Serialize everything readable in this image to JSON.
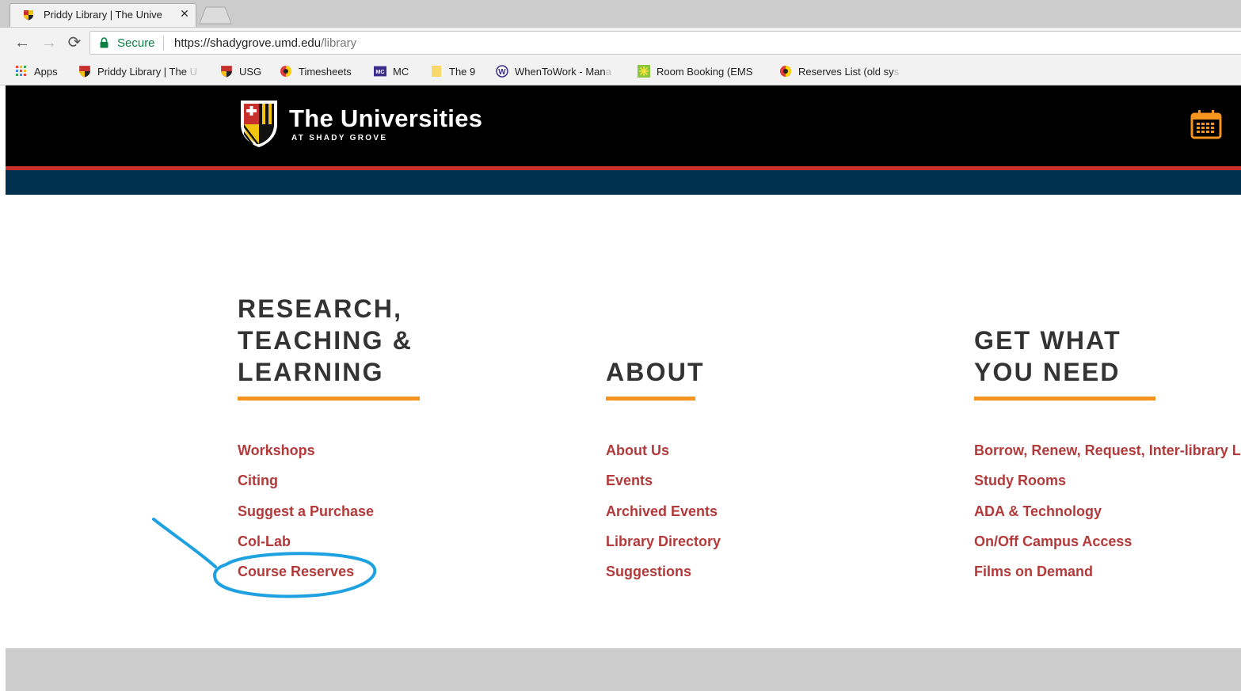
{
  "browser": {
    "tab_title": "Priddy Library | The Unive",
    "secure_label": "Secure",
    "url_host": "https://shadygrove.umd.edu",
    "url_path": "/library",
    "bookmarks": [
      {
        "label": "Apps",
        "icon": "apps-grid-icon"
      },
      {
        "label": "Priddy Library | The",
        "fade": " U",
        "icon": "usg-shield-icon"
      },
      {
        "label": "USG",
        "icon": "usg-shield-icon"
      },
      {
        "label": "Timesheets",
        "icon": "umd-globe-icon"
      },
      {
        "label": "MC",
        "icon": "mc-logo-icon"
      },
      {
        "label": "The 9",
        "icon": "folder-icon"
      },
      {
        "label": "WhenToWork - Man",
        "fade": "a",
        "icon": "whentowork-icon"
      },
      {
        "label": "Room Booking (EMS",
        "fade": "",
        "icon": "ems-icon"
      },
      {
        "label": "Reserves List (old sy",
        "fade": "s",
        "icon": "umd-globe-icon"
      }
    ]
  },
  "site": {
    "title": "The Universities",
    "subtitle": "AT SHADY GROVE"
  },
  "columns": [
    {
      "heading": [
        "RESEARCH,",
        "TEACHING &",
        "LEARNING"
      ],
      "links": [
        "Workshops",
        "Citing",
        "Suggest a Purchase",
        "Col-Lab",
        "Course Reserves"
      ]
    },
    {
      "heading": [
        "ABOUT"
      ],
      "links": [
        "About Us",
        "Events",
        "Archived Events",
        "Library Directory",
        "Suggestions"
      ]
    },
    {
      "heading": [
        "GET WHAT",
        "YOU NEED"
      ],
      "links": [
        "Borrow, Renew, Request, Inter-library Loan",
        "Study Rooms",
        "ADA & Technology",
        "On/Off Campus Access",
        "Films on Demand"
      ]
    }
  ],
  "colors": {
    "header_bg": "#000000",
    "red_rule": "#c8302e",
    "blue_band": "#00314f",
    "heading": "#333333",
    "accent_orange": "#f7941d",
    "link": "#b33a3a",
    "annotation": "#1ea1e0",
    "footer": "#cccccc"
  }
}
